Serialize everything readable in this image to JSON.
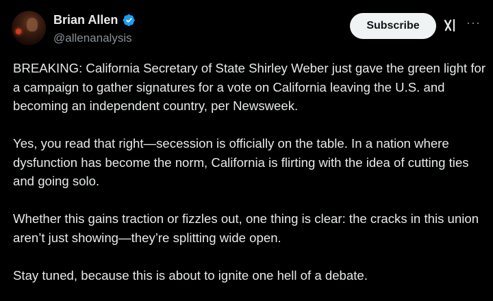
{
  "author": {
    "display_name": "Brian Allen",
    "handle": "@allenanalysis",
    "verified": true,
    "avatar": "profile-photo"
  },
  "actions": {
    "subscribe_label": "Subscribe",
    "grok_icon": "grok-icon",
    "more_icon": "more-options-icon"
  },
  "colors": {
    "background": "#000000",
    "text": "#e7e9ea",
    "secondary_text": "#8b9197",
    "verified_badge": "#1d9bf0",
    "subscribe_bg": "#eff3f4"
  },
  "tweet": {
    "paragraphs": [
      "BREAKING: California Secretary of State Shirley Weber just gave the green light for a campaign to gather signatures for a vote on California leaving the U.S. and becoming an independent country, per Newsweek.",
      "Yes, you read that right—secession is officially on the table. In a nation where dysfunction has become the norm, California is flirting with the idea of cutting ties and going solo.",
      "Whether this gains traction or fizzles out, one thing is clear: the cracks in this union aren’t just showing—they’re splitting wide open.",
      "Stay tuned, because this is about to ignite one hell of a debate."
    ]
  }
}
